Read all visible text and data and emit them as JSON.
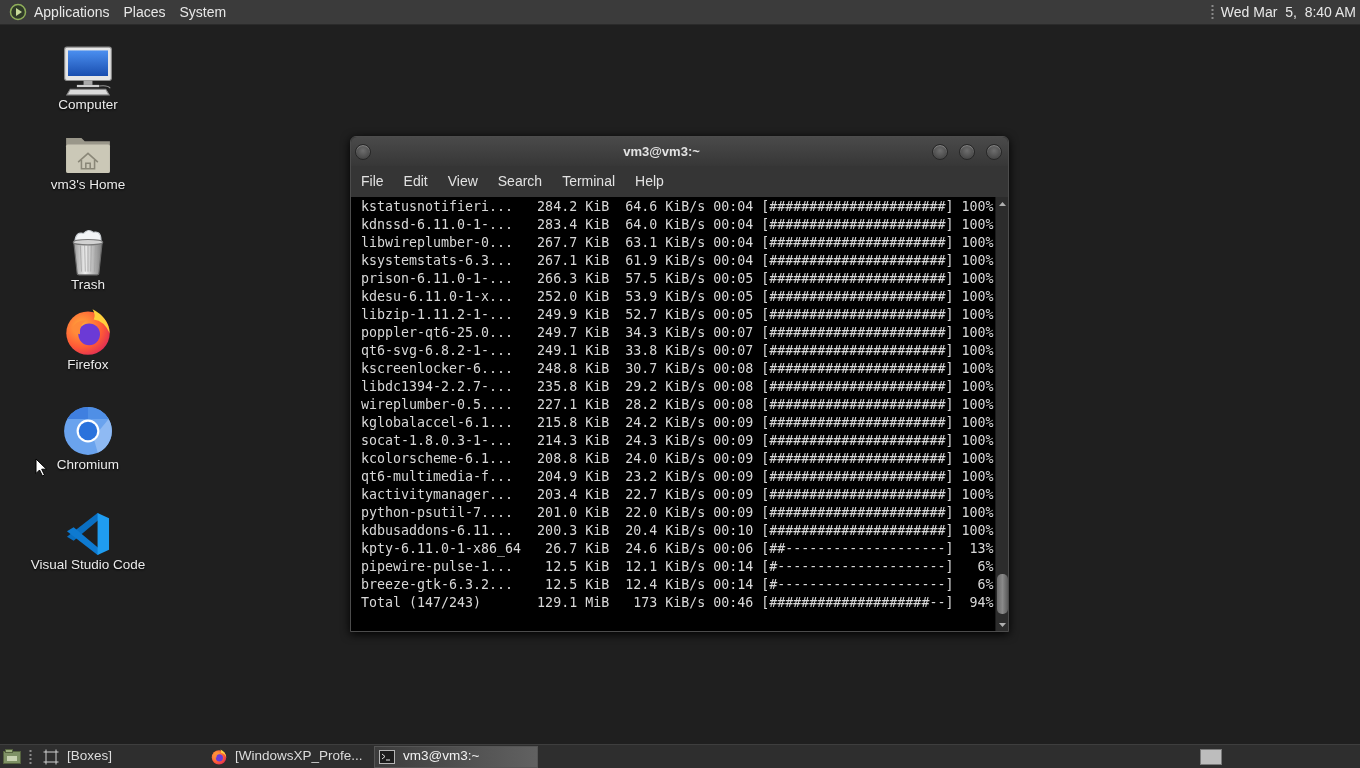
{
  "top_panel": {
    "menus": [
      "Applications",
      "Places",
      "System"
    ],
    "clock": "Wed Mar  5,  8:40 AM"
  },
  "desktop_icons": [
    {
      "kind": "computer",
      "label": "Computer"
    },
    {
      "kind": "home",
      "label": "vm3's Home"
    },
    {
      "kind": "trash",
      "label": "Trash"
    },
    {
      "kind": "firefox",
      "label": "Firefox"
    },
    {
      "kind": "chromium",
      "label": "Chromium"
    },
    {
      "kind": "vscode",
      "label": "Visual Studio Code"
    }
  ],
  "terminal_window": {
    "title": "vm3@vm3:~",
    "menu": [
      "File",
      "Edit",
      "View",
      "Search",
      "Terminal",
      "Help"
    ],
    "lines": [
      "kstatusnotifieri...   284.2 KiB  64.6 KiB/s 00:04 [######################] 100%",
      "kdnssd-6.11.0-1-...   283.4 KiB  64.0 KiB/s 00:04 [######################] 100%",
      "libwireplumber-0...   267.7 KiB  63.1 KiB/s 00:04 [######################] 100%",
      "ksystemstats-6.3...   267.1 KiB  61.9 KiB/s 00:04 [######################] 100%",
      "prison-6.11.0-1-...   266.3 KiB  57.5 KiB/s 00:05 [######################] 100%",
      "kdesu-6.11.0-1-x...   252.0 KiB  53.9 KiB/s 00:05 [######################] 100%",
      "libzip-1.11.2-1-...   249.9 KiB  52.7 KiB/s 00:05 [######################] 100%",
      "poppler-qt6-25.0...   249.7 KiB  34.3 KiB/s 00:07 [######################] 100%",
      "qt6-svg-6.8.2-1-...   249.1 KiB  33.8 KiB/s 00:07 [######################] 100%",
      "kscreenlocker-6....   248.8 KiB  30.7 KiB/s 00:08 [######################] 100%",
      "libdc1394-2.2.7-...   235.8 KiB  29.2 KiB/s 00:08 [######################] 100%",
      "wireplumber-0.5....   227.1 KiB  28.2 KiB/s 00:08 [######################] 100%",
      "kglobalaccel-6.1...   215.8 KiB  24.2 KiB/s 00:09 [######################] 100%",
      "socat-1.8.0.3-1-...   214.3 KiB  24.3 KiB/s 00:09 [######################] 100%",
      "kcolorscheme-6.1...   208.8 KiB  24.0 KiB/s 00:09 [######################] 100%",
      "qt6-multimedia-f...   204.9 KiB  23.2 KiB/s 00:09 [######################] 100%",
      "kactivitymanager...   203.4 KiB  22.7 KiB/s 00:09 [######################] 100%",
      "python-psutil-7....   201.0 KiB  22.0 KiB/s 00:09 [######################] 100%",
      "kdbusaddons-6.11...   200.3 KiB  20.4 KiB/s 00:10 [######################] 100%",
      "kpty-6.11.0-1-x86_64   26.7 KiB  24.6 KiB/s 00:06 [##--------------------]  13%",
      "pipewire-pulse-1...    12.5 KiB  12.1 KiB/s 00:14 [#---------------------]   6%",
      "breeze-gtk-6.3.2...    12.5 KiB  12.4 KiB/s 00:14 [#---------------------]   6%",
      "Total (147/243)       129.1 MiB   173 KiB/s 00:46 [####################--]  94%"
    ]
  },
  "taskbar": {
    "windows": [
      {
        "kind": "boxes",
        "label": "[Boxes]",
        "selected": false
      },
      {
        "kind": "firefox",
        "label": "[WindowsXP_Profe...",
        "selected": false
      },
      {
        "kind": "terminal",
        "label": "vm3@vm3:~",
        "selected": true
      }
    ]
  }
}
